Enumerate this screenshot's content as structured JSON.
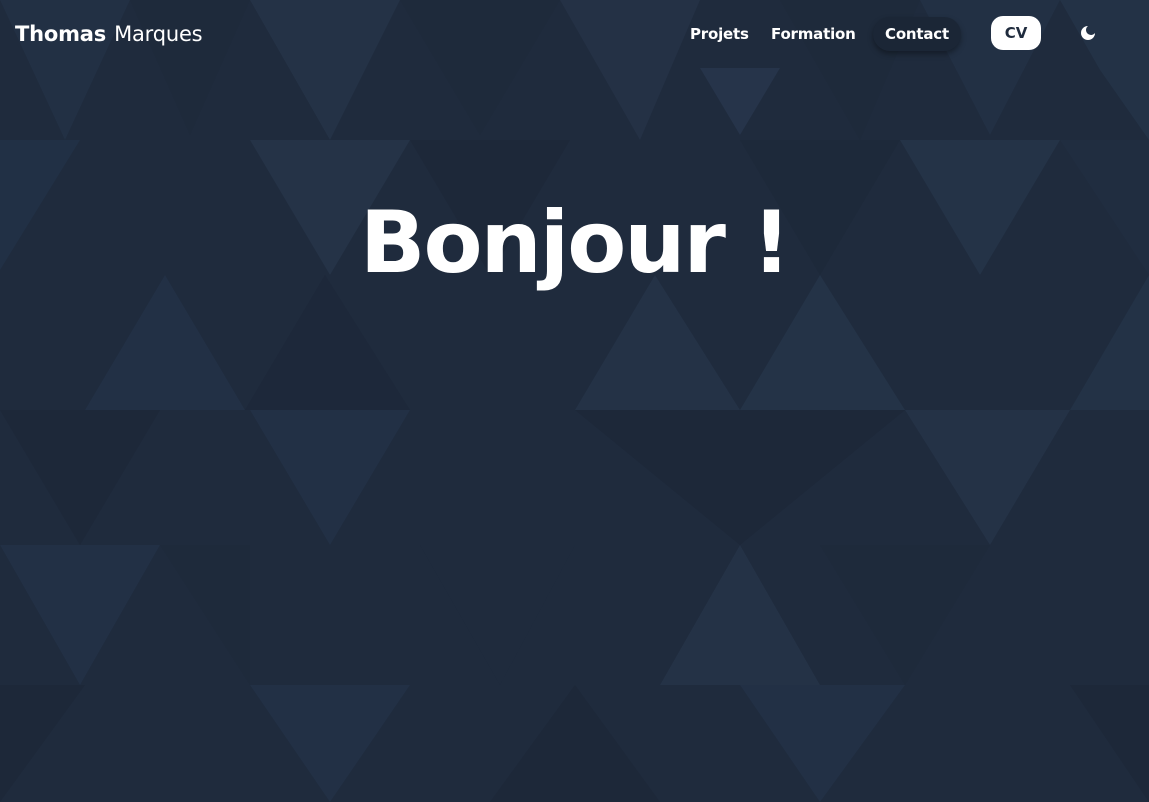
{
  "header": {
    "brand_first": "Thomas",
    "brand_last": "Marques",
    "nav": {
      "projets": "Projets",
      "formation": "Formation",
      "contact": "Contact",
      "cv": "CV"
    },
    "theme_toggle_icon": "moon-icon"
  },
  "hero": {
    "title": "Bonjour !"
  },
  "colors": {
    "background": "#1f2b3d",
    "text": "#ffffff",
    "cv_button_bg": "#ffffff",
    "contact_pill_bg": "#1b2636"
  }
}
